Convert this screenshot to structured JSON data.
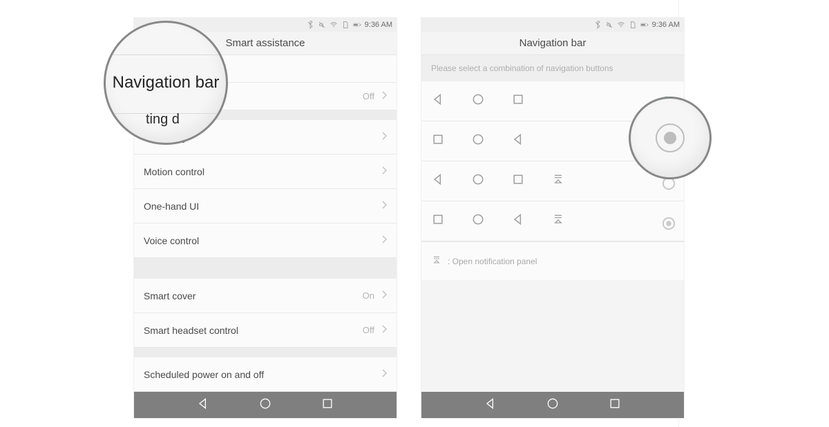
{
  "statusbar": {
    "time": "9:36 AM"
  },
  "left": {
    "title": "Smart assistance",
    "magnify_text": "Navigation bar",
    "magnify_fragment": "ting d",
    "rows": [
      {
        "label": "",
        "value": "Off",
        "chev": true
      },
      {
        "label": "Smart key",
        "chev": true
      },
      {
        "label": "Motion control",
        "chev": true
      },
      {
        "label": "One-hand UI",
        "chev": true
      },
      {
        "label": "Voice control",
        "chev": true
      }
    ],
    "rows2": [
      {
        "label": "Smart cover",
        "value": "On",
        "chev": true
      },
      {
        "label": "Smart headset control",
        "value": "Off",
        "chev": true
      }
    ],
    "rows3": [
      {
        "label": "Scheduled power on and off",
        "chev": true
      }
    ]
  },
  "right": {
    "title": "Navigation bar",
    "subtitle": "Please select a combination of navigation buttons",
    "options": [
      {
        "icons": [
          "back",
          "home",
          "recent"
        ],
        "selected": true
      },
      {
        "icons": [
          "recent",
          "home",
          "back"
        ],
        "selected": false
      },
      {
        "icons": [
          "back",
          "home",
          "recent",
          "notif"
        ],
        "selected": false
      },
      {
        "icons": [
          "recent",
          "home",
          "back",
          "notif"
        ],
        "selected": false
      }
    ],
    "hint": ": Open notification panel"
  }
}
